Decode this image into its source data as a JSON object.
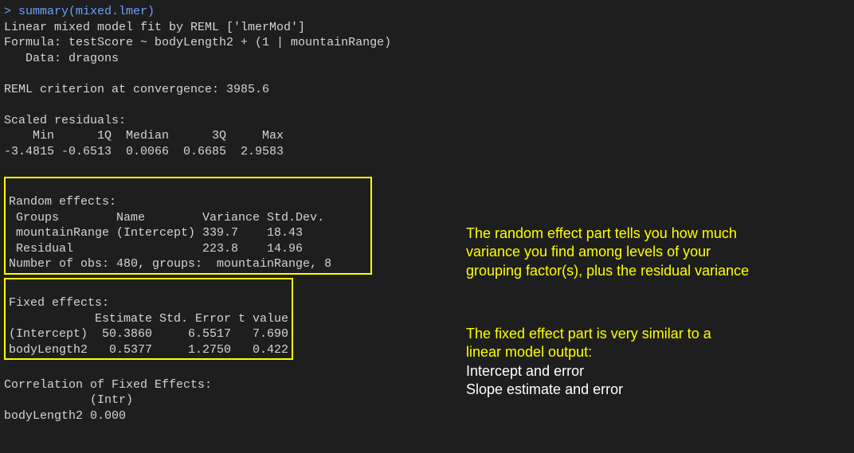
{
  "console": {
    "prompt": "> summary(mixed.lmer)",
    "header_line1": "Linear mixed model fit by REML ['lmerMod']",
    "header_line2": "Formula: testScore ~ bodyLength2 + (1 | mountainRange)",
    "header_line3": "   Data: dragons",
    "reml_line": "REML criterion at convergence: 3985.6",
    "residuals_title": "Scaled residuals:",
    "residuals_header": "    Min      1Q  Median      3Q     Max",
    "residuals_values": "-3.4815 -0.6513  0.0066  0.6685  2.9583",
    "random_title": "Random effects:",
    "random_header": " Groups        Name        Variance Std.Dev.",
    "random_line1": " mountainRange (Intercept) 339.7    18.43",
    "random_line2": " Residual                  223.8    14.96",
    "random_obs": "Number of obs: 480, groups:  mountainRange, 8",
    "fixed_title": "Fixed effects:",
    "fixed_header": "            Estimate Std. Error t value",
    "fixed_line1": "(Intercept)  50.3860     6.5517   7.690",
    "fixed_line2": "bodyLength2   0.5377     1.2750   0.422",
    "corr_title": "Correlation of Fixed Effects:",
    "corr_header": "            (Intr)",
    "corr_line1": "bodyLength2 0.000"
  },
  "annotations": {
    "random_yellow_1": "The random effect part tells you how much",
    "random_yellow_2": "variance you find among levels of your",
    "random_yellow_3": "grouping factor(s), plus the residual variance",
    "fixed_yellow_1": "The fixed effect part is very similar to a",
    "fixed_yellow_2": "linear model output:",
    "fixed_white_1": "Intercept and error",
    "fixed_white_2": "Slope estimate and error"
  }
}
